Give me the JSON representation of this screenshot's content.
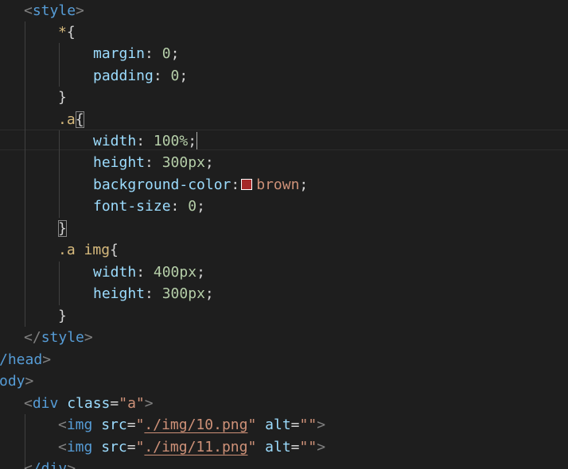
{
  "swatch_color": "#a52a2a",
  "code": {
    "style_open": "style",
    "universal_selector": "*",
    "margin_prop": "margin",
    "margin_value": "0",
    "padding_prop": "padding",
    "padding_value": "0",
    "class_selector": ".a",
    "width_prop": "width",
    "width_value": "100%",
    "height_prop": "height",
    "height_value": "300px",
    "bg_prop": "background-color",
    "bg_value": "brown",
    "fontsize_prop": "font-size",
    "fontsize_value": "0",
    "img_selector_class": ".a",
    "img_selector_tag": "img",
    "img_width_value": "400px",
    "img_height_value": "300px",
    "style_close": "style",
    "head_close": "/head",
    "body_fragment": "ody",
    "div_tag": "div",
    "class_attr": "class",
    "class_value": "\"a\"",
    "img_tag": "img",
    "src_attr": "src",
    "alt_attr": "alt",
    "empty_str": "\"\"",
    "img1_src": "./img/10.png",
    "img2_src": "./img/11.png",
    "div_close": "/div"
  }
}
